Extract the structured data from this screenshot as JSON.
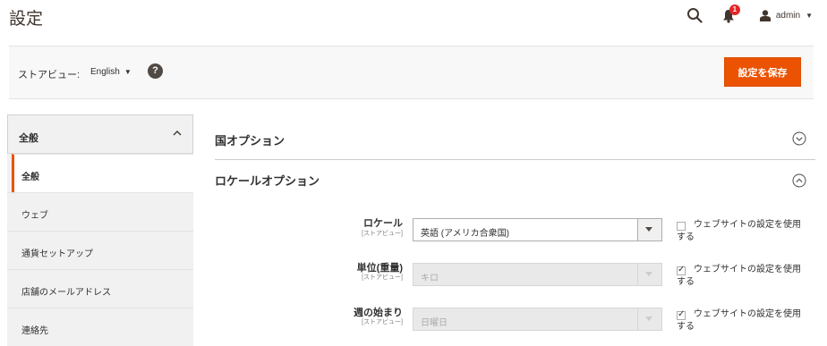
{
  "header": {
    "title": "設定",
    "notification_count": "1",
    "user_name": "admin"
  },
  "store_bar": {
    "label": "ストアビュー:",
    "store_value": "English",
    "help": "?",
    "save_label": "設定を保存"
  },
  "sidebar": {
    "group_title": "全般",
    "items": [
      {
        "label": "全般",
        "active": true
      },
      {
        "label": "ウェブ"
      },
      {
        "label": "通貨セットアップ"
      },
      {
        "label": "店舗のメールアドレス"
      },
      {
        "label": "連絡先"
      }
    ]
  },
  "sections": {
    "country_options": "国オプション",
    "locale_options": "ロケールオプション"
  },
  "fields": [
    {
      "label": "ロケール",
      "scope": "[ストアビュー]",
      "value": "英語 (アメリカ合衆国)",
      "disabled": false,
      "use_website": false,
      "use_website_label": "ウェブサイトの設定を使用する"
    },
    {
      "label": "単位(重量)",
      "scope": "[ストアビュー]",
      "value": "キロ",
      "disabled": true,
      "use_website": true,
      "use_website_label": "ウェブサイトの設定を使用する"
    },
    {
      "label": "週の始まり",
      "scope": "[ストアビュー]",
      "value": "日曜日",
      "disabled": true,
      "use_website": true,
      "use_website_label": "ウェブサイトの設定を使用する"
    }
  ],
  "colors": {
    "accent": "#eb5202",
    "badge": "#e22626",
    "help": "#514943"
  }
}
